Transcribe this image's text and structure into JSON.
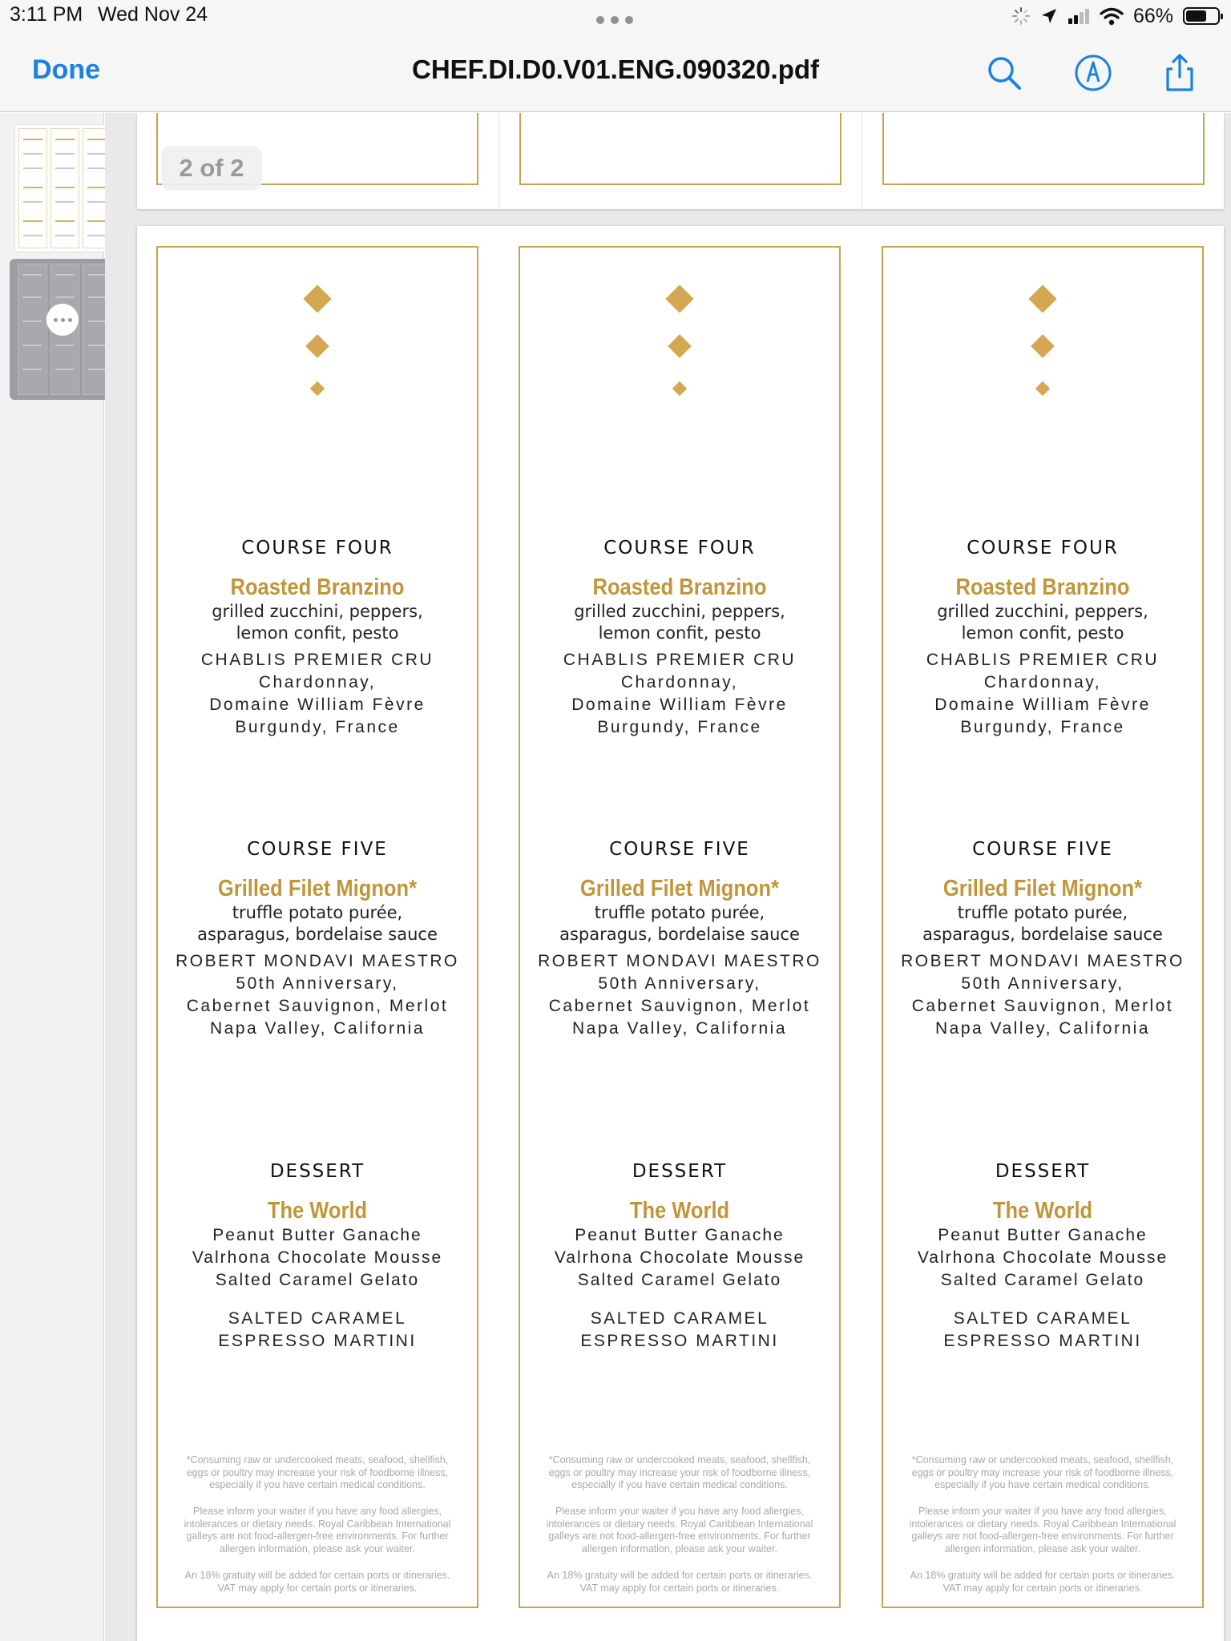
{
  "status_bar": {
    "time": "3:11 PM",
    "date": "Wed Nov 24",
    "battery_percent": "66%",
    "battery_level": 0.66
  },
  "nav": {
    "done_label": "Done",
    "title": "CHEF.DI.D0.V01.ENG.090320.pdf",
    "icons": [
      "search-icon",
      "markup-icon",
      "share-icon"
    ]
  },
  "viewer": {
    "page_indicator": "2 of 2",
    "thumbnails": 2,
    "selected_page": 2
  },
  "menu": {
    "course_four": {
      "heading": "COURSE FOUR",
      "dish": "Roasted Branzino",
      "desc": [
        "grilled zucchini, peppers,",
        "lemon confit, pesto"
      ],
      "wine": [
        "CHABLIS PREMIER CRU",
        "Chardonnay,",
        "Domaine William Fèvre",
        "Burgundy, France"
      ]
    },
    "course_five": {
      "heading": "COURSE FIVE",
      "dish": "Grilled Filet Mignon*",
      "desc": [
        "truffle potato purée,",
        "asparagus, bordelaise sauce"
      ],
      "wine": [
        "ROBERT MONDAVI MAESTRO",
        "50th Anniversary,",
        "Cabernet Sauvignon, Merlot",
        "Napa Valley, California"
      ]
    },
    "dessert": {
      "heading": "DESSERT",
      "dish": "The World",
      "desc": [
        "Peanut Butter Ganache",
        "Valrhona Chocolate Mousse",
        "Salted Caramel Gelato"
      ],
      "drink": [
        "SALTED CARAMEL",
        "ESPRESSO MARTINI"
      ]
    },
    "footnotes": {
      "consuming": [
        "*Consuming raw or undercooked meats, seafood, shellfish,",
        "eggs or poultry may increase your risk of foodborne illness,",
        "especially if you have certain medical conditions."
      ],
      "allergies": [
        "Please inform your waiter if you have any food allergies,",
        "intolerances or dietary needs. Royal Caribbean International",
        "galleys are not food-allergen-free environments. For further",
        "allergen information, please ask your waiter."
      ],
      "gratuity": [
        "An 18% gratuity will be added for certain ports or itineraries.",
        "VAT may apply for certain ports or itineraries."
      ]
    }
  },
  "colors": {
    "accent_blue": "#1a82e2",
    "gold": "#c1963a",
    "gold_border": "#c9a34e"
  }
}
